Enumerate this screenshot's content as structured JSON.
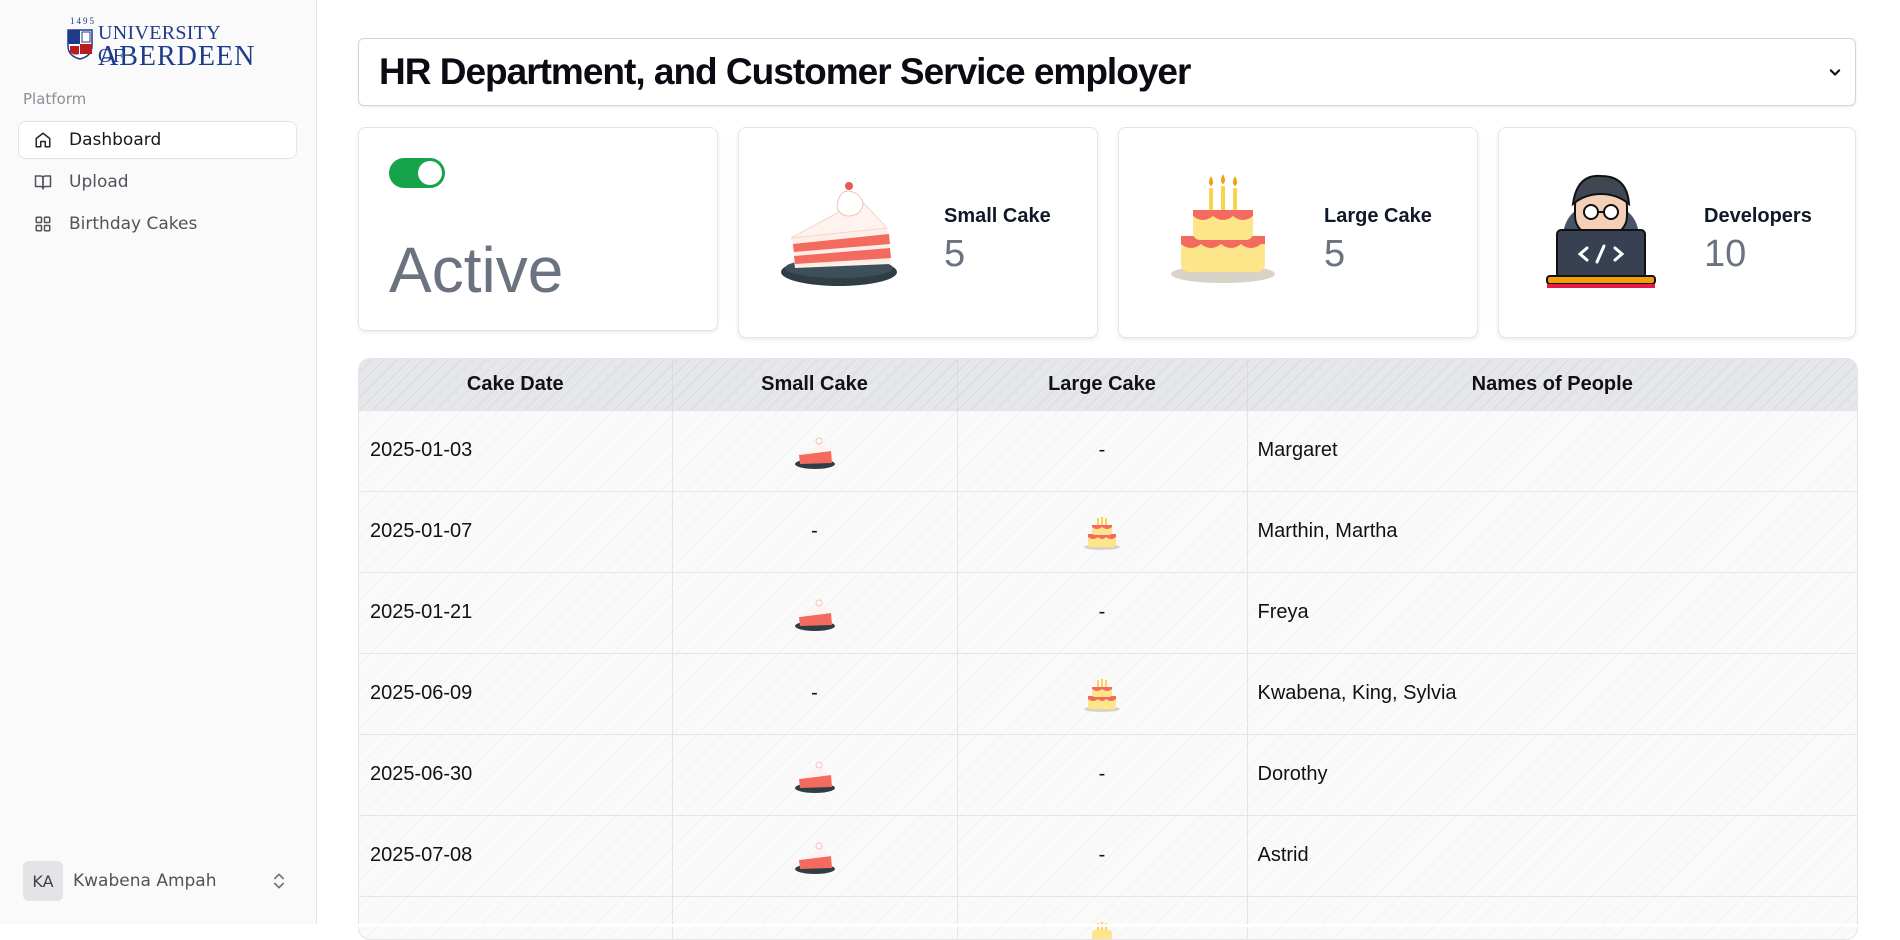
{
  "sidebar": {
    "logo": {
      "year": "1495",
      "university": "UNIVERSITY OF",
      "city": "ABERDEEN"
    },
    "section_label": "Platform",
    "items": [
      {
        "label": "Dashboard",
        "icon": "home-icon",
        "active": true
      },
      {
        "label": "Upload",
        "icon": "book-open-icon",
        "active": false
      },
      {
        "label": "Birthday Cakes",
        "icon": "grid-icon",
        "active": false
      }
    ],
    "user": {
      "initials": "KA",
      "name": "Kwabena Ampah"
    }
  },
  "header": {
    "title": "HR Department, and Customer Service employer"
  },
  "cards": {
    "status": {
      "text": "Active",
      "toggle_on": true
    },
    "small_cake": {
      "label": "Small Cake",
      "value": "5"
    },
    "large_cake": {
      "label": "Large Cake",
      "value": "5"
    },
    "developers": {
      "label": "Developers",
      "value": "10"
    }
  },
  "table": {
    "columns": [
      "Cake Date",
      "Small Cake",
      "Large Cake",
      "Names of People"
    ],
    "rows": [
      {
        "date": "2025-01-03",
        "small": "icon",
        "large": "-",
        "names": "Margaret"
      },
      {
        "date": "2025-01-07",
        "small": "-",
        "large": "icon",
        "names": "Marthin, Martha"
      },
      {
        "date": "2025-01-21",
        "small": "icon",
        "large": "-",
        "names": "Freya"
      },
      {
        "date": "2025-06-09",
        "small": "-",
        "large": "icon",
        "names": "Kwabena, King, Sylvia"
      },
      {
        "date": "2025-06-30",
        "small": "icon",
        "large": "-",
        "names": "Dorothy"
      },
      {
        "date": "2025-07-08",
        "small": "icon",
        "large": "-",
        "names": "Astrid"
      },
      {
        "date": "",
        "small": "",
        "large": "icon",
        "names": ""
      }
    ]
  },
  "colors": {
    "toggle_on": "#16a34a",
    "accent_cake": "#f26b5e",
    "brand_blue": "#1e3a8a"
  }
}
